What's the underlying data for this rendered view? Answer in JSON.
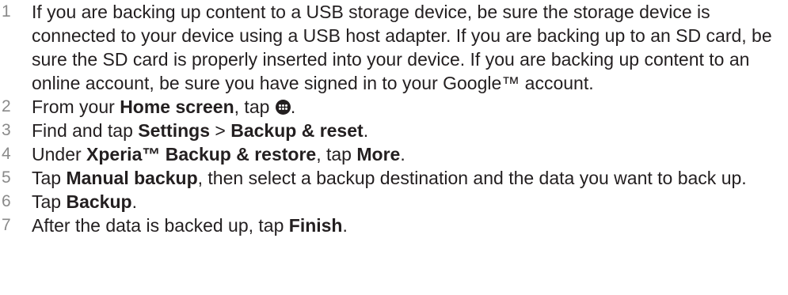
{
  "steps": [
    {
      "number": "1",
      "parts": [
        {
          "text": "If you are backing up content to a USB storage device, be sure the storage device is connected to your device using a USB host adapter. If you are backing up to an SD card, be sure the SD card is properly inserted into your device. If you are backing up content to an online account, be sure you have signed in to your Google™ account.",
          "bold": false
        }
      ]
    },
    {
      "number": "2",
      "parts": [
        {
          "text": "From your ",
          "bold": false
        },
        {
          "text": "Home screen",
          "bold": true
        },
        {
          "text": ", tap ",
          "bold": false
        },
        {
          "icon": "apps-icon"
        },
        {
          "text": ".",
          "bold": false
        }
      ]
    },
    {
      "number": "3",
      "parts": [
        {
          "text": "Find and tap ",
          "bold": false
        },
        {
          "text": "Settings",
          "bold": true
        },
        {
          "text": " > ",
          "bold": false
        },
        {
          "text": "Backup & reset",
          "bold": true
        },
        {
          "text": ".",
          "bold": false
        }
      ]
    },
    {
      "number": "4",
      "parts": [
        {
          "text": "Under ",
          "bold": false
        },
        {
          "text": "Xperia™ Backup & restore",
          "bold": true
        },
        {
          "text": ", tap ",
          "bold": false
        },
        {
          "text": "More",
          "bold": true
        },
        {
          "text": ".",
          "bold": false
        }
      ]
    },
    {
      "number": "5",
      "parts": [
        {
          "text": "Tap ",
          "bold": false
        },
        {
          "text": "Manual backup",
          "bold": true
        },
        {
          "text": ", then select a backup destination and the data you want to back up.",
          "bold": false
        }
      ]
    },
    {
      "number": "6",
      "parts": [
        {
          "text": "Tap ",
          "bold": false
        },
        {
          "text": "Backup",
          "bold": true
        },
        {
          "text": ".",
          "bold": false
        }
      ]
    },
    {
      "number": "7",
      "parts": [
        {
          "text": "After the data is backed up, tap ",
          "bold": false
        },
        {
          "text": "Finish",
          "bold": true
        },
        {
          "text": ".",
          "bold": false
        }
      ]
    }
  ]
}
